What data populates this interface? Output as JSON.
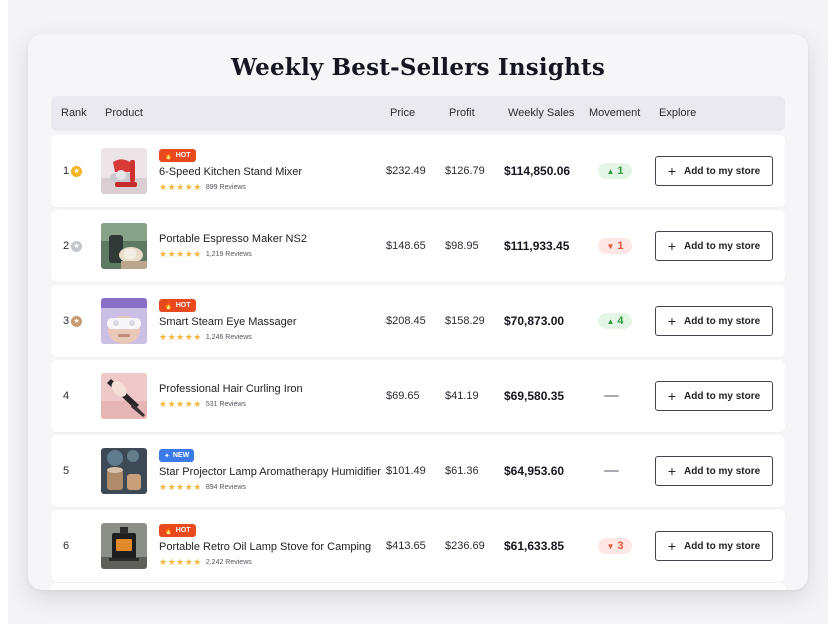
{
  "title": "Weekly Best-Sellers Insights",
  "columns": {
    "rank": "Rank",
    "product": "Product",
    "price": "Price",
    "profit": "Profit",
    "weekly_sales": "Weekly Sales",
    "movement": "Movement",
    "explore": "Explore"
  },
  "button_label": "Add to my store",
  "rows": [
    {
      "rank": "1",
      "medal": "gold",
      "badge": "HOT",
      "badge_type": "hot",
      "name": "6-Speed Kitchen Stand Mixer",
      "stars": "★★★★★",
      "reviews": "899 Reviews",
      "price": "$232.49",
      "profit": "$126.79",
      "sales": "$114,850.06",
      "movement": "1",
      "direction": "up"
    },
    {
      "rank": "2",
      "medal": "silver",
      "badge": "",
      "badge_type": "",
      "name": "Portable Espresso Maker NS2",
      "stars": "★★★★★",
      "reviews": "1,219 Reviews",
      "price": "$148.65",
      "profit": "$98.95",
      "sales": "$111,933.45",
      "movement": "1",
      "direction": "down"
    },
    {
      "rank": "3",
      "medal": "bronze",
      "badge": "HOT",
      "badge_type": "hot",
      "name": "Smart Steam Eye Massager",
      "stars": "★★★★★",
      "reviews": "1,246 Reviews",
      "price": "$208.45",
      "profit": "$158.29",
      "sales": "$70,873.00",
      "movement": "4",
      "direction": "up"
    },
    {
      "rank": "4",
      "medal": "",
      "badge": "",
      "badge_type": "",
      "name": "Professional Hair Curling Iron",
      "stars": "★★★★★",
      "reviews": "531 Reviews",
      "price": "$69.65",
      "profit": "$41.19",
      "sales": "$69,580.35",
      "movement": "",
      "direction": "flat"
    },
    {
      "rank": "5",
      "medal": "",
      "badge": "NEW",
      "badge_type": "new",
      "name": "Star Projector Lamp Aromatherapy Humidifier",
      "stars": "★★★★★",
      "reviews": "894 Reviews",
      "price": "$101.49",
      "profit": "$61.36",
      "sales": "$64,953.60",
      "movement": "",
      "direction": "flat"
    },
    {
      "rank": "6",
      "medal": "",
      "badge": "HOT",
      "badge_type": "hot",
      "name": "Portable Retro Oil Lamp Stove for Camping",
      "stars": "★★★★★",
      "reviews": "2,242 Reviews",
      "price": "$413.65",
      "profit": "$236.69",
      "sales": "$61,633.85",
      "movement": "3",
      "direction": "down"
    }
  ],
  "colors": {
    "hot_badge": "#e84a1d",
    "new_badge": "#3b7ae8",
    "up": "#2f9a3f",
    "down": "#e4533a",
    "stars": "#f4b63f"
  }
}
